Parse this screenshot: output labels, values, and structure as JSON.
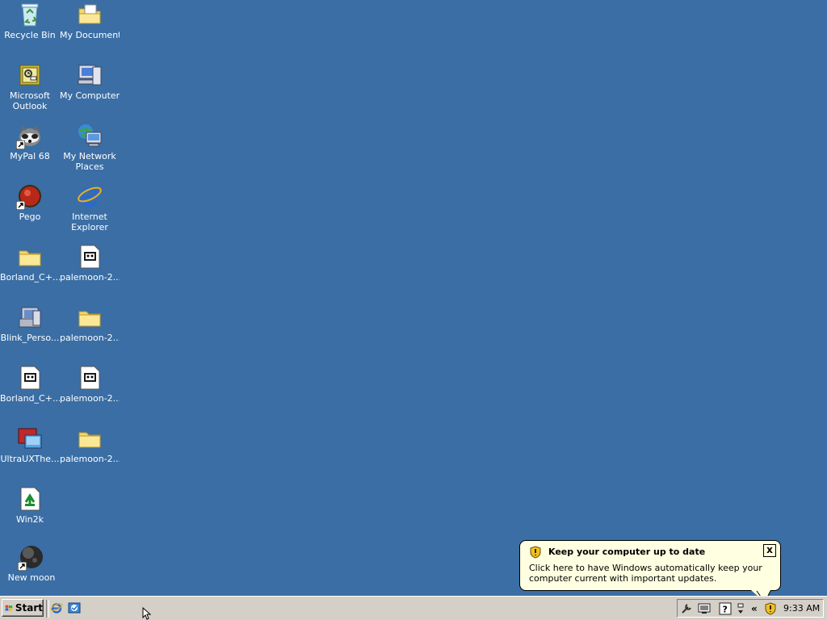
{
  "desktop": {
    "background": "#3a6ea5",
    "icons": [
      {
        "label": "Recycle Bin",
        "icon": "recycle-bin-icon"
      },
      {
        "label": "My Documents",
        "icon": "folder-documents-icon"
      },
      {
        "label": "Microsoft Outlook",
        "icon": "outlook-icon"
      },
      {
        "label": "My Computer",
        "icon": "computer-icon"
      },
      {
        "label": "MyPal 68",
        "icon": "mypal-icon"
      },
      {
        "label": "My Network Places",
        "icon": "network-icon"
      },
      {
        "label": "Pego",
        "icon": "pego-icon"
      },
      {
        "label": "Internet Explorer",
        "icon": "ie-icon"
      },
      {
        "label": "Borland_C+...",
        "icon": "folder-icon"
      },
      {
        "label": "palemoon-2...",
        "icon": "installer-icon"
      },
      {
        "label": "Blink_Perso...",
        "icon": "blink-icon"
      },
      {
        "label": "palemoon-2...",
        "icon": "folder-icon"
      },
      {
        "label": "Borland_C+...",
        "icon": "installer-icon"
      },
      {
        "label": "palemoon-2...",
        "icon": "installer-icon"
      },
      {
        "label": "UltraUXThe...",
        "icon": "ultraux-icon"
      },
      {
        "label": "palemoon-2...",
        "icon": "folder-icon"
      },
      {
        "label": "Win2k",
        "icon": "win2k-file-icon"
      },
      {
        "label": "New moon",
        "icon": "new-moon-icon"
      }
    ]
  },
  "taskbar": {
    "start_label": "Start",
    "quick_launch": [
      "ie-icon",
      "outlook-express-icon"
    ],
    "tray": {
      "icons": [
        "tools-icon",
        "display-icon",
        "help-icon",
        "volume-icon",
        "expand-chevron-icon",
        "security-shield-icon"
      ],
      "chevron_label": "«",
      "clock": "9:33 AM"
    }
  },
  "balloon": {
    "title": "Keep your computer up to date",
    "body": "Click here to have Windows automatically keep your computer current with important updates.",
    "close_label": "x"
  }
}
